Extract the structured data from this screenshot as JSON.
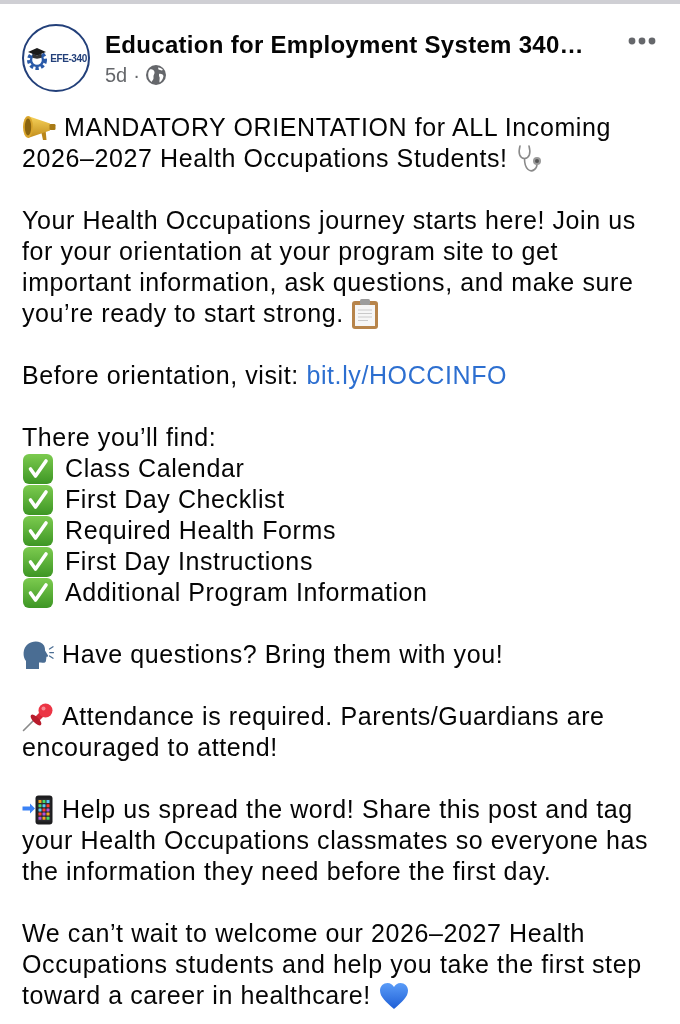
{
  "post": {
    "author": {
      "logo_text": "EFE-340",
      "name": "Education for Employment System 340…",
      "time": "5d",
      "separator": "·"
    },
    "headline": [
      "MANDATORY ORIENTATION for ALL Incoming",
      "2026–2027 Health Occupations Students!"
    ],
    "intro": [
      "Your Health Occupations journey starts here! Join us for your orientation at your program site to get important information, ask questions, and make sure",
      "you’re ready to start strong."
    ],
    "resource": {
      "text": "Before orientation, visit:",
      "link": "bit.ly/HOCCINFO"
    },
    "checklist": {
      "heading": "There you’ll find:",
      "items": [
        "Class Calendar",
        "First Day Checklist",
        "Required Health Forms",
        "First Day Instructions",
        "Additional Program Information"
      ]
    },
    "questions": "Have questions? Bring them with you!",
    "attendance": [
      "Attendance is required. Parents/Guardians are",
      "encouraged to attend!"
    ],
    "share": [
      "Help us spread the word! Share this post and tag",
      "your Health Occupations classmates so everyone has the information they need before the first day."
    ],
    "closing": [
      "We can’t wait to welcome our 2026–2027 Health Occupations students and help you take the first step",
      "toward a career in healthcare!"
    ]
  }
}
